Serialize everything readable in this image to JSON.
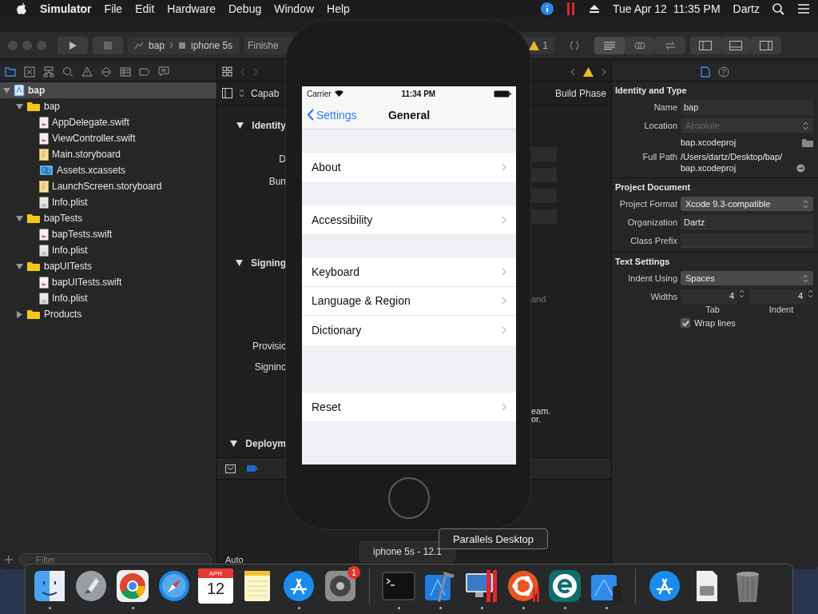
{
  "menu_bar": {
    "app": "Simulator",
    "items": [
      "File",
      "Edit",
      "Hardware",
      "Debug",
      "Window",
      "Help"
    ],
    "clock": "Tue Apr 12  11:35 PM",
    "user": "Dartz"
  },
  "toolbar": {
    "scheme": "bap",
    "device": "iphone 5s",
    "status": "Finishe",
    "warnings": "1",
    "panels": [
      {
        "kind": "navigator",
        "on": true
      },
      {
        "kind": "debug",
        "on": true
      },
      {
        "kind": "inspector",
        "on": true
      }
    ]
  },
  "navigator": {
    "filter_placeholder": "Filter",
    "tree": [
      {
        "name": "bap",
        "kind": "project",
        "expanded": true,
        "selected": true,
        "children": [
          {
            "name": "bap",
            "kind": "folder",
            "expanded": true,
            "selected": false,
            "children": [
              {
                "name": "AppDelegate.swift",
                "kind": "swift",
                "selected": false
              },
              {
                "name": "ViewController.swift",
                "kind": "swift",
                "selected": false
              },
              {
                "name": "Main.storyboard",
                "kind": "storyboard",
                "selected": false
              },
              {
                "name": "Assets.xcassets",
                "kind": "assets",
                "selected": false
              },
              {
                "name": "LaunchScreen.storyboard",
                "kind": "storyboard",
                "selected": false
              },
              {
                "name": "Info.plist",
                "kind": "plist",
                "selected": false
              }
            ]
          },
          {
            "name": "bapTests",
            "kind": "folder",
            "expanded": true,
            "selected": false,
            "children": [
              {
                "name": "bapTests.swift",
                "kind": "swift",
                "selected": false
              },
              {
                "name": "Info.plist",
                "kind": "plist",
                "selected": false
              }
            ]
          },
          {
            "name": "bapUITests",
            "kind": "folder",
            "expanded": true,
            "selected": false,
            "children": [
              {
                "name": "bapUITests.swift",
                "kind": "swift",
                "selected": false
              },
              {
                "name": "Info.plist",
                "kind": "plist",
                "selected": false
              }
            ]
          },
          {
            "name": "Products",
            "kind": "folder",
            "expanded": false,
            "selected": false
          }
        ]
      }
    ]
  },
  "editor": {
    "tab": "Capab",
    "right_tab": "Build Phase",
    "layout_button": "Auto",
    "left_labels": [
      {
        "text": "Identity",
        "kind": "section"
      },
      {
        "text": "D",
        "kind": "label"
      },
      {
        "text": "Bun",
        "kind": "label"
      },
      {
        "text": "Signing",
        "kind": "section"
      },
      {
        "text": "Provisic",
        "kind": "label"
      },
      {
        "text": "Signinc",
        "kind": "label"
      },
      {
        "text": "Deploym",
        "kind": "section"
      }
    ],
    "right_texts": [
      "and",
      "eam.",
      "or."
    ]
  },
  "inspector": {
    "sections": [
      {
        "title": "Identity and Type",
        "rows": [
          {
            "label": "Name",
            "kind": "text",
            "value": "bap"
          },
          {
            "label": "Location",
            "kind": "select",
            "value": "Absolute",
            "disabled": true
          },
          {
            "label": "Full Path",
            "kind": "path",
            "file": "bap.xcodeproj",
            "lines": [
              "/Users/dartz/Desktop/bap/",
              "bap.xcodeproj"
            ]
          }
        ]
      },
      {
        "title": "Project Document",
        "rows": [
          {
            "label": "Project Format",
            "kind": "select",
            "value": "Xcode 9.3-compatible",
            "disabled": false
          },
          {
            "label": "Organization",
            "kind": "text",
            "value": "Dartz"
          },
          {
            "label": "Class Prefix",
            "kind": "text"
          }
        ]
      },
      {
        "title": "Text Settings",
        "rows": [
          {
            "label": "Indent Using",
            "kind": "select",
            "value": "Spaces",
            "disabled": false
          },
          {
            "label": "Widths",
            "kind": "steppers",
            "steppers": [
              {
                "value": "4",
                "caption": "Tab"
              },
              {
                "value": "4",
                "caption": "Indent"
              }
            ]
          },
          {
            "label": "Wrap lines",
            "kind": "checkbox",
            "checked": true
          }
        ]
      }
    ]
  },
  "simulator": {
    "carrier": "Carrier",
    "time": "11:34 PM",
    "back": "Settings",
    "title": "General",
    "device_label": "iphone 5s - 12.1",
    "groups": [
      [
        "About"
      ],
      [
        "Accessibility"
      ],
      [
        "Keyboard",
        "Language & Region",
        "Dictionary"
      ],
      [
        "Reset"
      ]
    ]
  },
  "tooltip": "Parallels Desktop",
  "dock": [
    {
      "kind": "finder",
      "running": true
    },
    {
      "kind": "launchpad",
      "running": false
    },
    {
      "kind": "chrome",
      "running": true
    },
    {
      "kind": "safari",
      "running": false
    },
    {
      "kind": "calendar",
      "running": false,
      "month": "APR",
      "day": "12"
    },
    {
      "kind": "notes",
      "running": false
    },
    {
      "kind": "appstore",
      "running": true
    },
    {
      "kind": "prefs",
      "running": false,
      "badge": "1"
    },
    {
      "kind": "separator"
    },
    {
      "kind": "terminal",
      "running": true
    },
    {
      "kind": "xcode",
      "running": true
    },
    {
      "kind": "parallels",
      "running": true
    },
    {
      "kind": "ubuntu",
      "running": true
    },
    {
      "kind": "eset",
      "running": true
    },
    {
      "kind": "simulator",
      "running": true
    },
    {
      "kind": "separator"
    },
    {
      "kind": "appstore",
      "running": false
    },
    {
      "kind": "disk",
      "running": false
    },
    {
      "kind": "trash",
      "running": false
    }
  ]
}
